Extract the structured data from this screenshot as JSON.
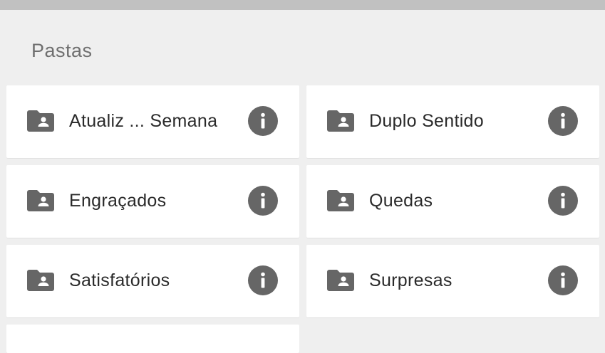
{
  "header": {
    "section_title": "Pastas"
  },
  "colors": {
    "background": "#efefef",
    "top_bar": "#c1c1c1",
    "card": "#ffffff",
    "icon": "#666666",
    "text": "#2a2a2a",
    "section_title": "#6f6f6f"
  },
  "folders": [
    {
      "label": "Atualiz ... Semana",
      "icon": "shared-folder-icon",
      "action_icon": "info-icon"
    },
    {
      "label": "Duplo Sentido",
      "icon": "shared-folder-icon",
      "action_icon": "info-icon"
    },
    {
      "label": "Engraçados",
      "icon": "shared-folder-icon",
      "action_icon": "info-icon"
    },
    {
      "label": "Quedas",
      "icon": "shared-folder-icon",
      "action_icon": "info-icon"
    },
    {
      "label": "Satisfatórios",
      "icon": "shared-folder-icon",
      "action_icon": "info-icon"
    },
    {
      "label": "Surpresas",
      "icon": "shared-folder-icon",
      "action_icon": "info-icon"
    }
  ]
}
